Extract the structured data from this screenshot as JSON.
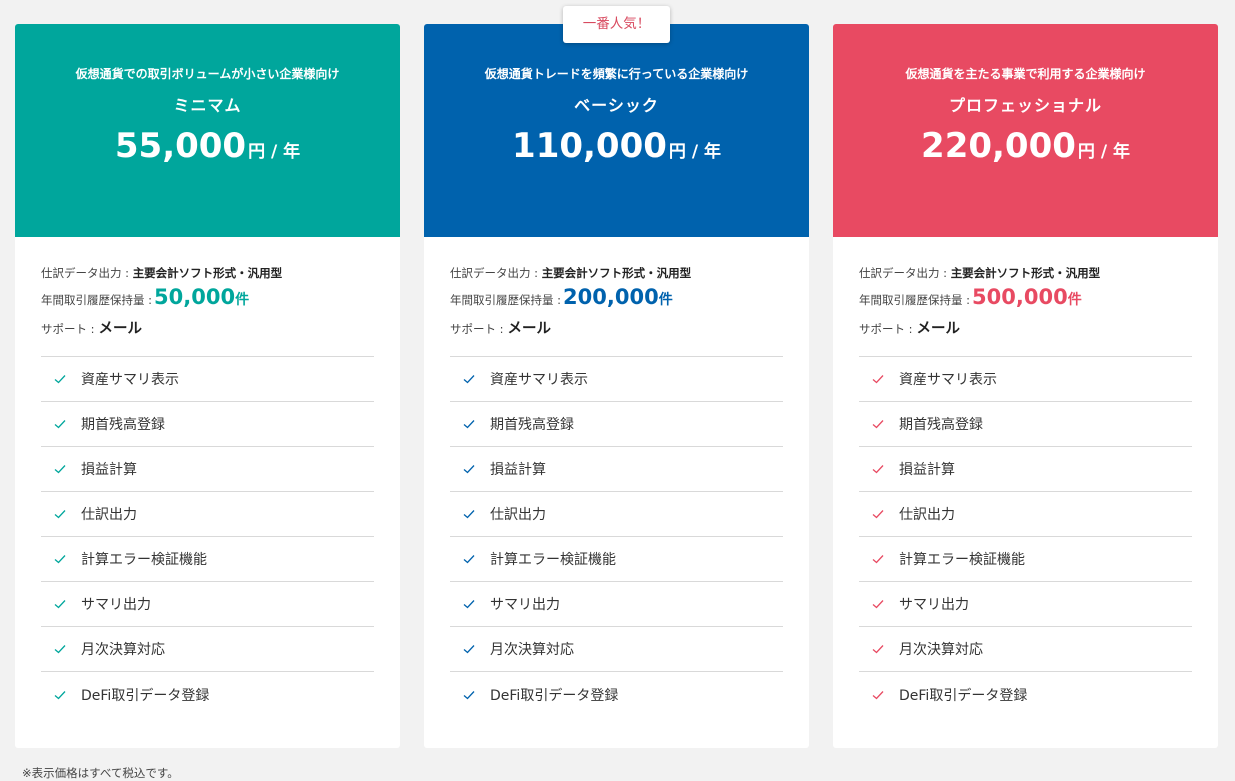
{
  "badge": "一番人気！",
  "spec_labels": {
    "export": "仕訳データ出力 : ",
    "export_value": "主要会計ソフト形式・汎用型",
    "history": "年間取引履歴保持量 : ",
    "history_unit": "件",
    "support": "サポート : ",
    "support_value": "メール"
  },
  "plans": [
    {
      "audience": "仮想通貨での取引ボリュームが小さい企業様向け",
      "name": "ミニマム",
      "price": "55,000",
      "unit": "円 / 年",
      "history": "50,000",
      "color": "#00a69c"
    },
    {
      "audience": "仮想通貨トレードを頻繁に行っている企業様向け",
      "name": "ベーシック",
      "price": "110,000",
      "unit": "円 / 年",
      "history": "200,000",
      "color": "#0062ad"
    },
    {
      "audience": "仮想通貨を主たる事業で利用する企業様向け",
      "name": "プロフェッショナル",
      "price": "220,000",
      "unit": "円 / 年",
      "history": "500,000",
      "color": "#e84a62"
    }
  ],
  "features": [
    "資産サマリ表示",
    "期首残高登録",
    "損益計算",
    "仕訳出力",
    "計算エラー検証機能",
    "サマリ出力",
    "月次決算対応",
    "DeFi取引データ登録"
  ],
  "check_icon": "check-icon",
  "note": "※表示価格はすべて税込です。"
}
